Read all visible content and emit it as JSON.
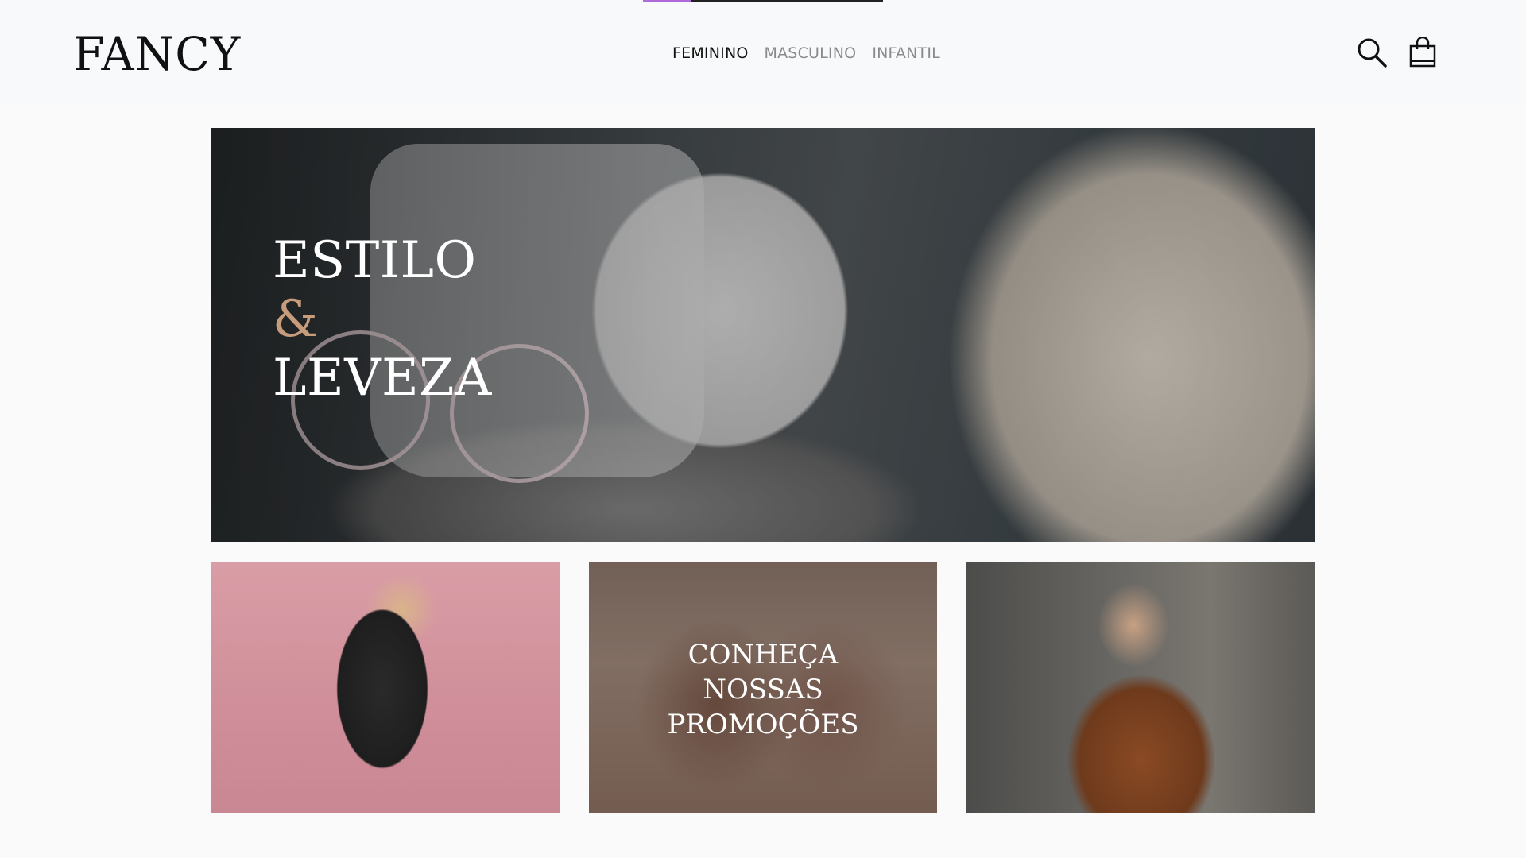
{
  "loading_bar": {
    "progress": 0.2
  },
  "brand": {
    "logo": "FANCY"
  },
  "nav": {
    "items": [
      {
        "label": "FEMININO",
        "active": true
      },
      {
        "label": "MASCULINO",
        "active": false
      },
      {
        "label": "INFANTIL",
        "active": false
      }
    ]
  },
  "header_icons": [
    "search-icon",
    "shopping-bag-icon"
  ],
  "hero": {
    "line1": "ESTILO",
    "line2": "&",
    "line3": "LEVEZA"
  },
  "cards": {
    "promo": {
      "line1": "CONHEÇA",
      "line2": "NOSSAS",
      "line3": "PROMOÇÕES"
    }
  },
  "colors": {
    "accent": "#c79c7c",
    "loading": "#b06ad9",
    "text_dark": "#111111",
    "nav_inactive": "#8a8a8a"
  }
}
